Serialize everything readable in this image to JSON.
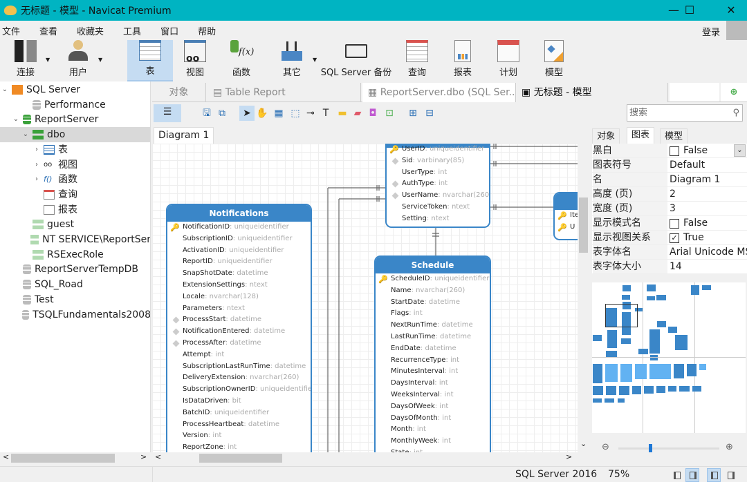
{
  "window": {
    "title": "无标题 - 模型 - Navicat Premium",
    "accent": "#00b4c2"
  },
  "menu": [
    "文件",
    "查看",
    "收藏夹",
    "工具",
    "窗口",
    "帮助"
  ],
  "login": "登录",
  "toolbar": [
    {
      "label": "连接",
      "icon": "plug-server-icon"
    },
    {
      "label": "用户",
      "icon": "user-icon"
    },
    {
      "label": "表",
      "icon": "table-icon",
      "active": true
    },
    {
      "label": "视图",
      "icon": "view-glasses-icon"
    },
    {
      "label": "函数",
      "icon": "function-icon"
    },
    {
      "label": "其它",
      "icon": "tools-icon"
    },
    {
      "label": "SQL Server 备份",
      "icon": "backup-tape-icon"
    },
    {
      "label": "查询",
      "icon": "query-icon"
    },
    {
      "label": "报表",
      "icon": "report-icon"
    },
    {
      "label": "计划",
      "icon": "calendar-clock-icon"
    },
    {
      "label": "模型",
      "icon": "model-icon"
    }
  ],
  "tree": [
    {
      "label": "SQL Server",
      "icon": "server"
    },
    {
      "label": "Performance",
      "icon": "db"
    },
    {
      "label": "ReportServer",
      "icon": "db-open"
    },
    {
      "label": "dbo",
      "icon": "schema",
      "selected": true
    },
    {
      "label": "表",
      "icon": "table"
    },
    {
      "label": "视图",
      "icon": "view"
    },
    {
      "label": "函数",
      "icon": "function"
    },
    {
      "label": "查询",
      "icon": "query"
    },
    {
      "label": "报表",
      "icon": "report"
    },
    {
      "label": "guest",
      "icon": "schema"
    },
    {
      "label": "NT SERVICE\\ReportSer",
      "icon": "schema"
    },
    {
      "label": "RSExecRole",
      "icon": "schema"
    },
    {
      "label": "ReportServerTempDB",
      "icon": "db"
    },
    {
      "label": "SQL_Road",
      "icon": "db"
    },
    {
      "label": "Test",
      "icon": "db"
    },
    {
      "label": "TSQLFundamentals2008",
      "icon": "db"
    }
  ],
  "tabs": [
    "对象",
    "Table Report",
    "ReportServer.dbo (SQL Ser...",
    "无标题 - 模型"
  ],
  "diagram_tab": "Diagram 1",
  "search": {
    "placeholder": "搜索"
  },
  "entities": {
    "users": {
      "rows": [
        [
          "UserID",
          "uniqueidentifier",
          "pk"
        ],
        [
          "Sid",
          "varbinary(85)",
          "idx"
        ],
        [
          "UserType",
          "int",
          ""
        ],
        [
          "AuthType",
          "int",
          "idx"
        ],
        [
          "UserName",
          "nvarchar(260)",
          "idx"
        ],
        [
          "ServiceToken",
          "ntext",
          ""
        ],
        [
          "Setting",
          "ntext",
          ""
        ]
      ]
    },
    "notifications": {
      "title": "Notifications",
      "rows": [
        [
          "NotificationID",
          "uniqueidentifier",
          "pk"
        ],
        [
          "SubscriptionID",
          "uniqueidentifier",
          ""
        ],
        [
          "ActivationID",
          "uniqueidentifier",
          ""
        ],
        [
          "ReportID",
          "uniqueidentifier",
          ""
        ],
        [
          "SnapShotDate",
          "datetime",
          ""
        ],
        [
          "ExtensionSettings",
          "ntext",
          ""
        ],
        [
          "Locale",
          "nvarchar(128)",
          ""
        ],
        [
          "Parameters",
          "ntext",
          ""
        ],
        [
          "ProcessStart",
          "datetime",
          "idx"
        ],
        [
          "NotificationEntered",
          "datetime",
          "idx"
        ],
        [
          "ProcessAfter",
          "datetime",
          "idx"
        ],
        [
          "Attempt",
          "int",
          ""
        ],
        [
          "SubscriptionLastRunTime",
          "datetime",
          ""
        ],
        [
          "DeliveryExtension",
          "nvarchar(260)",
          ""
        ],
        [
          "SubscriptionOwnerID",
          "uniqueidentifier",
          ""
        ],
        [
          "IsDataDriven",
          "bit",
          ""
        ],
        [
          "BatchID",
          "uniqueidentifier",
          ""
        ],
        [
          "ProcessHeartbeat",
          "datetime",
          ""
        ],
        [
          "Version",
          "int",
          ""
        ],
        [
          "ReportZone",
          "int",
          ""
        ]
      ]
    },
    "schedule": {
      "title": "Schedule",
      "rows": [
        [
          "ScheduleID",
          "uniqueidentifier",
          "pk"
        ],
        [
          "Name",
          "nvarchar(260)",
          ""
        ],
        [
          "StartDate",
          "datetime",
          ""
        ],
        [
          "Flags",
          "int",
          ""
        ],
        [
          "NextRunTime",
          "datetime",
          ""
        ],
        [
          "LastRunTime",
          "datetime",
          ""
        ],
        [
          "EndDate",
          "datetime",
          ""
        ],
        [
          "RecurrenceType",
          "int",
          ""
        ],
        [
          "MinutesInterval",
          "int",
          ""
        ],
        [
          "DaysInterval",
          "int",
          ""
        ],
        [
          "WeeksInterval",
          "int",
          ""
        ],
        [
          "DaysOfWeek",
          "int",
          ""
        ],
        [
          "DaysOfMonth",
          "int",
          ""
        ],
        [
          "Month",
          "int",
          ""
        ],
        [
          "MonthlyWeek",
          "int",
          ""
        ],
        [
          "State",
          "int",
          ""
        ]
      ]
    },
    "partial": {
      "rows": [
        [
          "Ite",
          "",
          "pk"
        ],
        [
          "U",
          "",
          "pk"
        ]
      ]
    }
  },
  "property_tabs": [
    "对象",
    "图表",
    "模型"
  ],
  "properties": [
    {
      "label": "黑白",
      "value": "False",
      "checkbox": false,
      "dropdown": true
    },
    {
      "label": "图表符号",
      "value": "Default"
    },
    {
      "label": "名",
      "value": "Diagram 1"
    },
    {
      "label": "高度 (页)",
      "value": "2"
    },
    {
      "label": "宽度 (页)",
      "value": "3"
    },
    {
      "label": "显示模式名",
      "value": "False",
      "checkbox": false
    },
    {
      "label": "显示视图关系",
      "value": "True",
      "checkbox": true
    },
    {
      "label": "表字体名",
      "value": "Arial Unicode MS"
    },
    {
      "label": "表字体大小",
      "value": "14"
    }
  ],
  "zoom_slider": 0.3,
  "status": {
    "db": "SQL Server 2016",
    "zoom": "75%"
  }
}
